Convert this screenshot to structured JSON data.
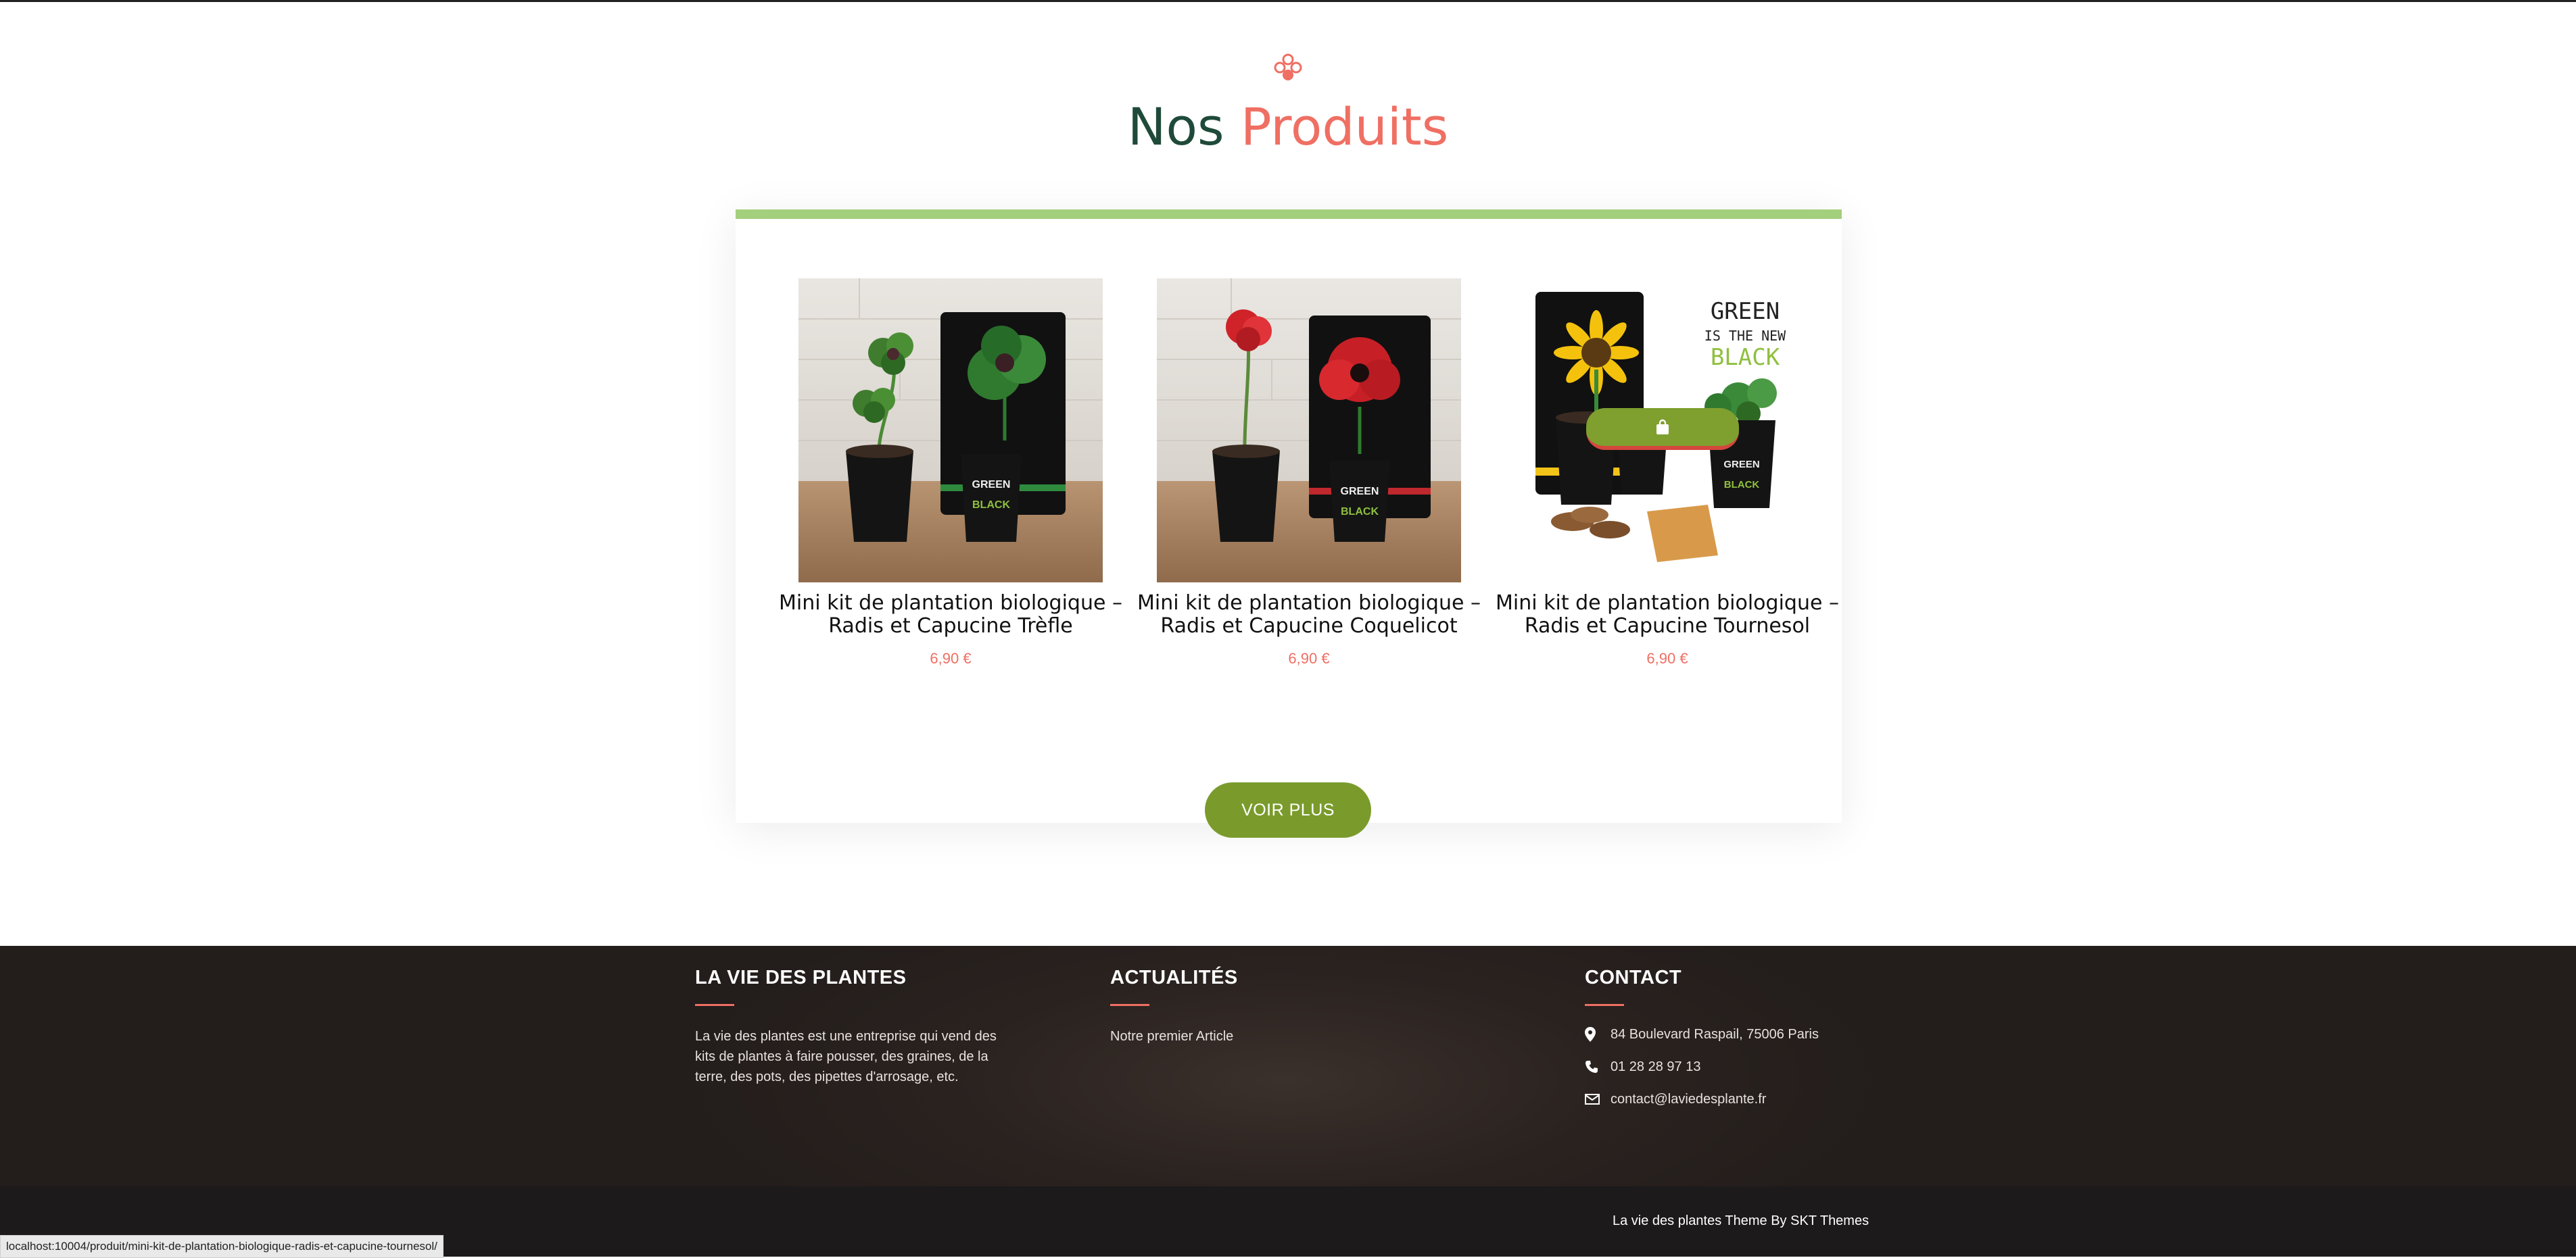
{
  "section": {
    "title_part1": "Nos",
    "title_part2": "Produits",
    "ornament_icon": "flower-ornament-icon",
    "title_color": "#1f4a3a",
    "accent_color": "#ef6f63"
  },
  "products": [
    {
      "name": "Mini kit de plantation biologique – Radis et Capucine Trèfle",
      "price": "6,90 €",
      "image_icon": "clover-plant-image"
    },
    {
      "name": "Mini kit de plantation biologique – Radis et Capucine Coquelicot",
      "price": "6,90 €",
      "image_icon": "poppy-plant-image"
    },
    {
      "name": "Mini kit de plantation biologique – Radis et Capucine Tournesol",
      "price": "6,90 €",
      "image_icon": "sunflower-plant-image",
      "overlay_icon": "shopping-bag-icon"
    }
  ],
  "product_image_text": {
    "pot_text_1": "GREEN",
    "pot_text_2": "IS THE NEW",
    "pot_text_3": "BLACK"
  },
  "voir_plus_label": "VOIR PLUS",
  "footer": {
    "about": {
      "heading": "LA VIE DES PLANTES",
      "text": "La vie des plantes est une entreprise qui vend des kits de plantes à faire pousser, des graines, de la terre, des pots, des pipettes d'arrosage, etc."
    },
    "news": {
      "heading": "ACTUALITÉS",
      "link": "Notre premier Article"
    },
    "contact": {
      "heading": "CONTACT",
      "address": "84 Boulevard Raspail, 75006 Paris",
      "phone": "01 28 28 97 13",
      "email": "contact@laviedesplante.fr"
    },
    "credits": "La vie des plantes Theme By SKT Themes"
  },
  "status_url": "localhost:10004/produit/mini-kit-de-plantation-biologique-radis-et-capucine-tournesol/",
  "colors": {
    "brand_green": "#7a9b2c",
    "card_border": "#a4cf7d",
    "price_color": "#ef6f63",
    "footer_bg": "#2a221f",
    "bottom_bar_bg": "#1c1a1a"
  }
}
